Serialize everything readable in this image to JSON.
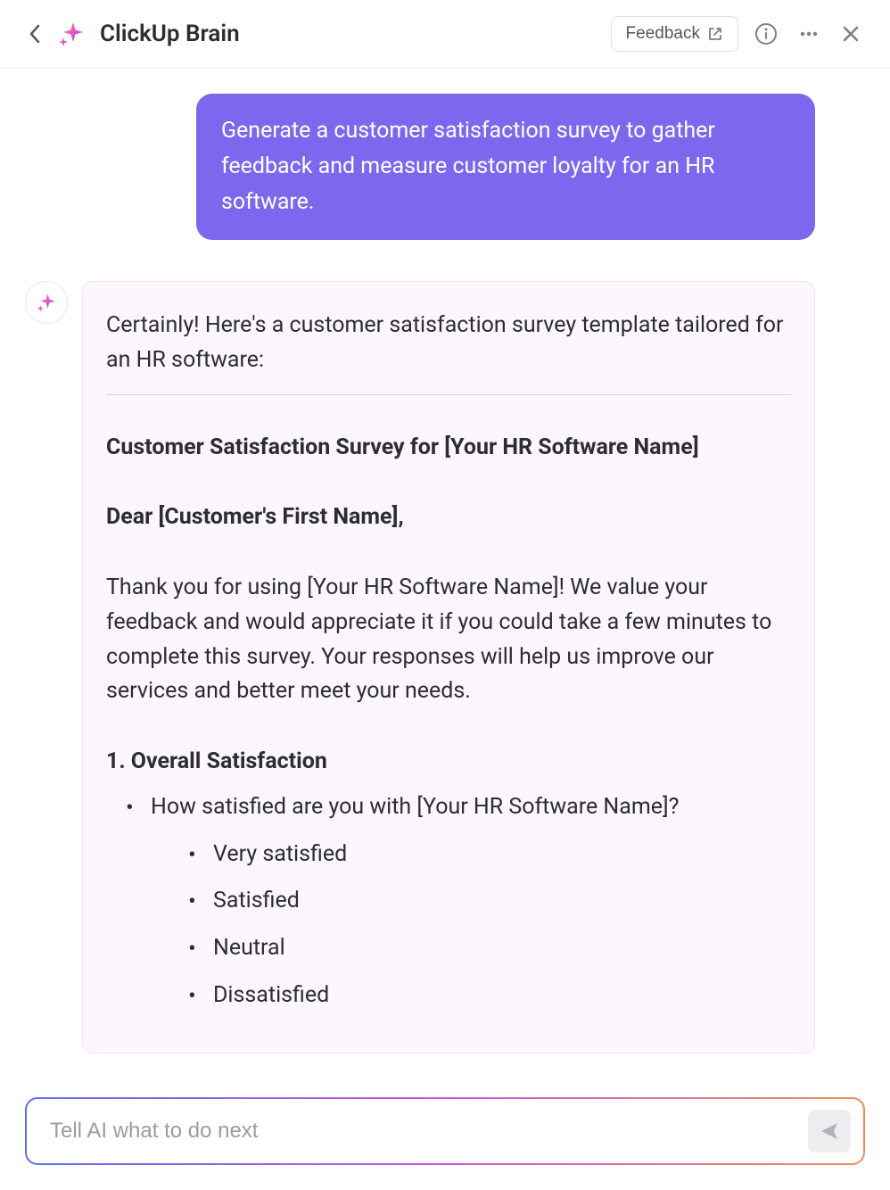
{
  "header": {
    "title": "ClickUp Brain",
    "feedback_label": "Feedback"
  },
  "chat": {
    "user_message": "Generate a customer satisfaction survey to gather feedback and measure customer loyalty for an HR software.",
    "assistant": {
      "intro": "Certainly! Here's a customer satisfaction survey template tailored for an HR software:",
      "survey_title": "Customer Satisfaction Survey for [Your HR Software Name]",
      "salutation": "Dear [Customer's First Name],",
      "body": "Thank you for using [Your HR Software Name]! We value your feedback and would appreciate it if you could take a few minutes to complete this survey. Your responses will help us improve our services and better meet your needs.",
      "section1": {
        "heading": "1. Overall Satisfaction",
        "question": "How satisfied are you with [Your HR Software Name]?",
        "options": [
          "Very satisfied",
          "Satisfied",
          "Neutral",
          "Dissatisfied"
        ]
      }
    }
  },
  "input": {
    "placeholder": "Tell AI what to do next"
  }
}
